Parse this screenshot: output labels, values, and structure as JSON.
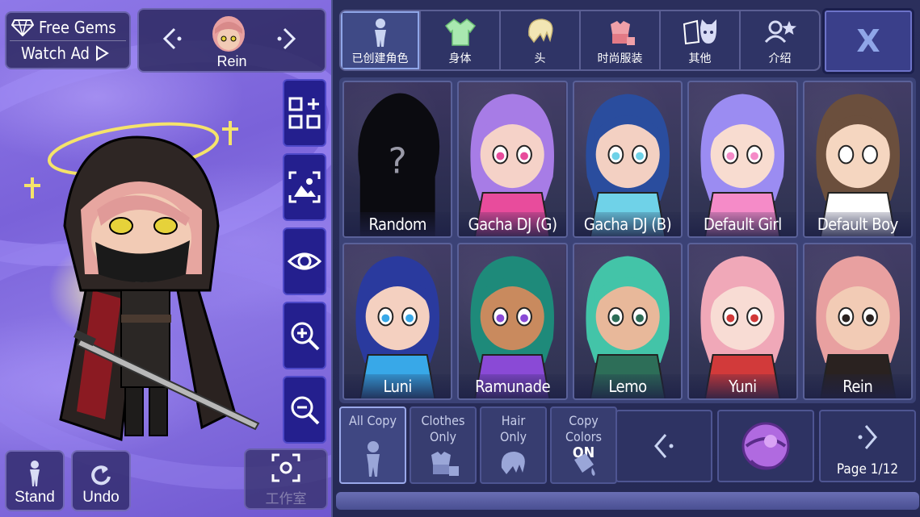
{
  "promo": {
    "free_gems_label": "Free Gems",
    "watch_ad_label": "Watch Ad"
  },
  "character": {
    "name": "Rein"
  },
  "tools": [
    "presets-icon",
    "background-photo-icon",
    "visibility-eye-icon",
    "zoom-in-icon",
    "zoom-out-icon"
  ],
  "bottom": {
    "stand_label": "Stand",
    "undo_label": "Undo",
    "studio_label": "工作室"
  },
  "tabs": [
    {
      "label": "已创建角色",
      "icon": "character-silhouette-icon",
      "active": true
    },
    {
      "label": "身体",
      "icon": "shirt-icon",
      "active": false
    },
    {
      "label": "头",
      "icon": "hair-head-icon",
      "active": false
    },
    {
      "label": "时尚服装",
      "icon": "outfit-icon",
      "active": false
    },
    {
      "label": "其他",
      "icon": "misc-pet-icon",
      "active": false
    },
    {
      "label": "介绍",
      "icon": "profile-star-icon",
      "active": false
    }
  ],
  "close_label": "X",
  "presets": [
    {
      "name": "Random",
      "hair": "#000000",
      "accent": "#000000",
      "skin": "#000000"
    },
    {
      "name": "Gacha DJ (G)",
      "hair": "#a77ce6",
      "accent": "#e84c9c",
      "skin": "#f5d2c8"
    },
    {
      "name": "Gacha DJ (B)",
      "hair": "#2a4d9e",
      "accent": "#6fd2e8",
      "skin": "#f3d0c2"
    },
    {
      "name": "Default Girl",
      "hair": "#9b8cf2",
      "accent": "#f58bc8",
      "skin": "#f8dcd0"
    },
    {
      "name": "Default Boy",
      "hair": "#6b4f3d",
      "accent": "#ffffff",
      "skin": "#f5d6c0"
    },
    {
      "name": "Luni",
      "hair": "#2a3a9e",
      "accent": "#38a8e8",
      "skin": "#f4d0c0"
    },
    {
      "name": "Ramunade",
      "hair": "#1e8a7a",
      "accent": "#8a4ad6",
      "skin": "#c98a5e"
    },
    {
      "name": "Lemo",
      "hair": "#43c4a8",
      "accent": "#2d6e58",
      "skin": "#e8b89a"
    },
    {
      "name": "Yuni",
      "hair": "#f0a8b8",
      "accent": "#d23a3a",
      "skin": "#f8dcd4"
    },
    {
      "name": "Rein",
      "hair": "#e8a0a0",
      "accent": "#2a2220",
      "skin": "#f2cbb5"
    }
  ],
  "copy_options": [
    {
      "line1": "All Copy",
      "line2": "",
      "active": true
    },
    {
      "line1": "Clothes",
      "line2": "Only",
      "active": false
    },
    {
      "line1": "Hair",
      "line2": "Only",
      "active": false
    },
    {
      "line1": "Copy Colors",
      "line2": "ON",
      "active": false
    }
  ],
  "pagination": {
    "page_label": "Page 1/12"
  },
  "colors": {
    "panel_bg": "#2b2f5c",
    "tool_btn": "#241f8e",
    "stage_purple": "#8f79e8",
    "tab_active": "#3f4a86"
  }
}
